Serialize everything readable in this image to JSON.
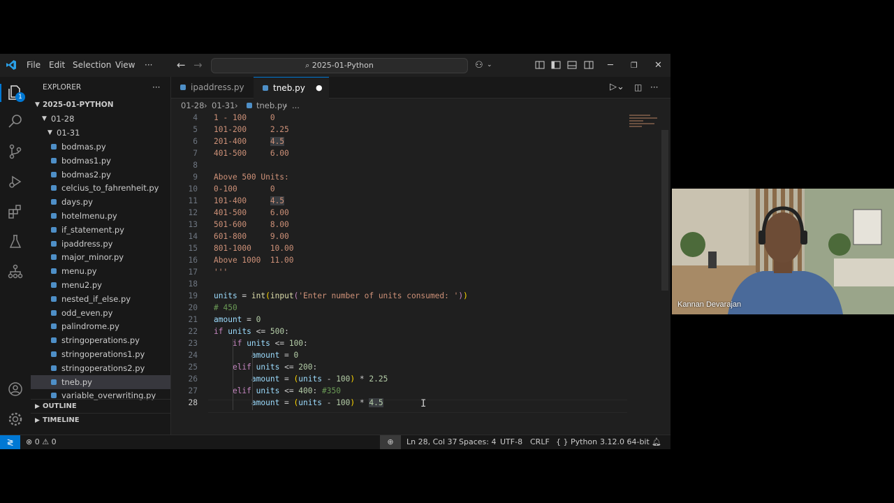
{
  "titlebar": {
    "menu": [
      "File",
      "Edit",
      "Selection",
      "View",
      "···"
    ],
    "search_text": "2025-01-Python"
  },
  "sidebar": {
    "header": "EXPLORER",
    "root": "2025-01-PYTHON",
    "folder1": "01-28",
    "folder2": "01-31",
    "files": [
      "bodmas.py",
      "bodmas1.py",
      "bodmas2.py",
      "celcius_to_fahrenheit.py",
      "days.py",
      "hotelmenu.py",
      "if_statement.py",
      "ipaddress.py",
      "major_minor.py",
      "menu.py",
      "menu2.py",
      "nested_if_else.py",
      "odd_even.py",
      "palindrome.py",
      "stringoperations.py",
      "stringoperations1.py",
      "stringoperations2.py",
      "tneb.py",
      "variable_overwriting.py"
    ],
    "selected": "tneb.py",
    "outline": "OUTLINE",
    "timeline": "TIMELINE"
  },
  "badge": "1",
  "tabs": [
    {
      "label": "ipaddress.py",
      "active": false
    },
    {
      "label": "tneb.py",
      "active": true,
      "dirty": "●"
    }
  ],
  "breadcrumb": [
    "01-28",
    "›",
    "01-31",
    "›",
    "tneb.py",
    "›",
    "..."
  ],
  "code": {
    "line_numbers": [
      "4",
      "5",
      "6",
      "7",
      "8",
      "9",
      "10",
      "11",
      "12",
      "13",
      "14",
      "15",
      "16",
      "17",
      "18",
      "19",
      "20",
      "21",
      "22",
      "23",
      "24",
      "25",
      "26",
      "27",
      "28"
    ],
    "current_line": "28"
  },
  "status": {
    "errors": "0",
    "warnings": "0",
    "position": "Ln 28, Col 37",
    "spaces": "Spaces: 4",
    "encoding": "UTF-8",
    "eol": "CRLF",
    "language": "Python",
    "interpreter": "3.12.0 64-bit"
  },
  "video": {
    "name": "Kannan Devarajan"
  },
  "colors": {
    "accent": "#0078d4",
    "remote": "#0078d4"
  }
}
